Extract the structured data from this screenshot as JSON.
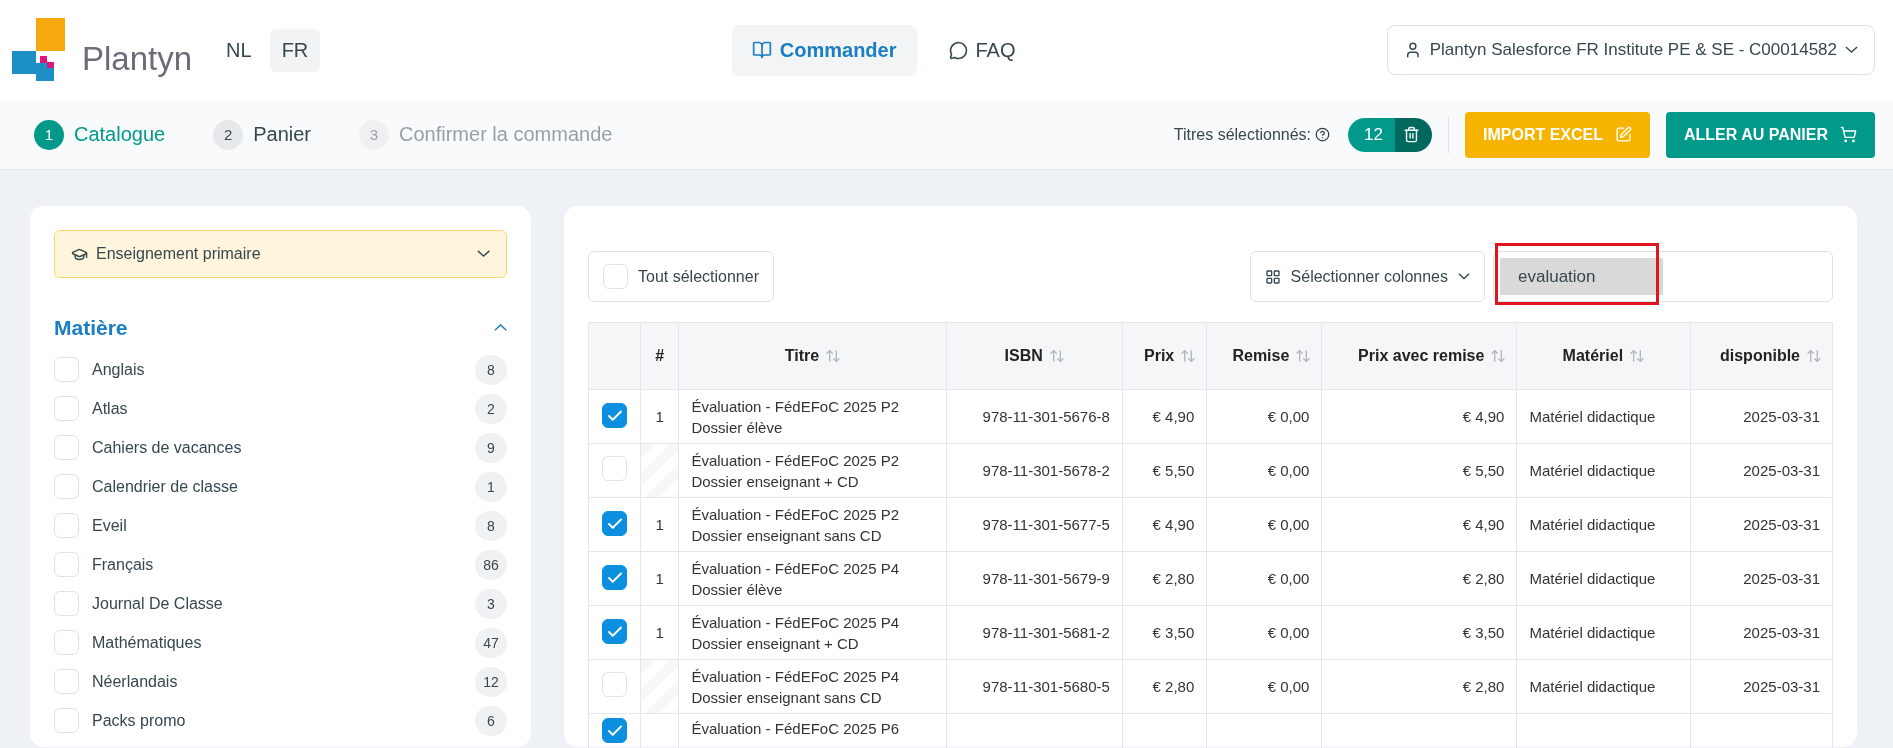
{
  "header": {
    "logo_text": "Plantyn",
    "languages": [
      {
        "label": "NL",
        "selected": false
      },
      {
        "label": "FR",
        "selected": true
      }
    ],
    "nav": [
      {
        "label": "Commander",
        "kind": "order",
        "selected": true
      },
      {
        "label": "FAQ",
        "kind": "faq",
        "selected": false
      }
    ],
    "account": "Plantyn Salesforce FR Institute PE & SE - C00014582"
  },
  "steps": [
    {
      "number": "1",
      "label": "Catalogue",
      "selected": true,
      "disabled": false
    },
    {
      "number": "2",
      "label": "Panier",
      "selected": false,
      "disabled": false
    },
    {
      "number": "3",
      "label": "Confirmer la commande",
      "selected": false,
      "disabled": true
    }
  ],
  "selection": {
    "label": "Titres sélectionnés:",
    "count": "12"
  },
  "actions": [
    {
      "label": "IMPORT EXCEL",
      "kind": "import"
    },
    {
      "label": "ALLER AU PANIER",
      "kind": "cart"
    }
  ],
  "sidebar": {
    "level_select": "Enseignement primaire",
    "section": {
      "title": "Matière",
      "expanded": true,
      "items": [
        {
          "label": "Anglais",
          "count": "8",
          "checked": false
        },
        {
          "label": "Atlas",
          "count": "2",
          "checked": false
        },
        {
          "label": "Cahiers de vacances",
          "count": "9",
          "checked": false
        },
        {
          "label": "Calendrier de classe",
          "count": "1",
          "checked": false
        },
        {
          "label": "Eveil",
          "count": "8",
          "checked": false
        },
        {
          "label": "Français",
          "count": "86",
          "checked": false
        },
        {
          "label": "Journal De Classe",
          "count": "3",
          "checked": false
        },
        {
          "label": "Mathématiques",
          "count": "47",
          "checked": false
        },
        {
          "label": "Néerlandais",
          "count": "12",
          "checked": false
        },
        {
          "label": "Packs promo",
          "count": "6",
          "checked": false
        }
      ]
    }
  },
  "toolbar": {
    "select_all": {
      "label": "Tout sélectionner",
      "checked": false
    },
    "columns_button": "Sélectionner colonnes",
    "search": {
      "value": "evaluation",
      "highlighted": true
    }
  },
  "table": {
    "columns": [
      {
        "label": "#",
        "sortable": false
      },
      {
        "label": "Titre",
        "sortable": true
      },
      {
        "label": "ISBN",
        "sortable": true
      },
      {
        "label": "Prix",
        "sortable": true
      },
      {
        "label": "Remise",
        "sortable": true
      },
      {
        "label": "Prix avec remise",
        "sortable": true
      },
      {
        "label": "Matériel",
        "sortable": true
      },
      {
        "label": "disponible",
        "sortable": true
      }
    ],
    "rows": [
      {
        "checked": true,
        "quantity": "1",
        "title": [
          "Évaluation - FédEFoC 2025 P2",
          "Dossier élève"
        ],
        "isbn": "978-11-301-5676-8",
        "price": "€ 4,90",
        "discount": "€ 0,00",
        "net_price": "€ 4,90",
        "material": "Matériel didactique",
        "available": "2025-03-31"
      },
      {
        "checked": false,
        "title": [
          "Évaluation - FédEFoC 2025 P2",
          "Dossier enseignant + CD"
        ],
        "isbn": "978-11-301-5678-2",
        "price": "€ 5,50",
        "discount": "€ 0,00",
        "net_price": "€ 5,50",
        "material": "Matériel didactique",
        "available": "2025-03-31"
      },
      {
        "checked": true,
        "quantity": "1",
        "title": [
          "Évaluation - FédEFoC 2025 P2",
          "Dossier enseignant sans CD"
        ],
        "isbn": "978-11-301-5677-5",
        "price": "€ 4,90",
        "discount": "€ 0,00",
        "net_price": "€ 4,90",
        "material": "Matériel didactique",
        "available": "2025-03-31"
      },
      {
        "checked": true,
        "quantity": "1",
        "title": [
          "Évaluation - FédEFoC 2025 P4",
          "Dossier élève"
        ],
        "isbn": "978-11-301-5679-9",
        "price": "€ 2,80",
        "discount": "€ 0,00",
        "net_price": "€ 2,80",
        "material": "Matériel didactique",
        "available": "2025-03-31"
      },
      {
        "checked": true,
        "quantity": "1",
        "title": [
          "Évaluation - FédEFoC 2025 P4",
          "Dossier enseignant + CD"
        ],
        "isbn": "978-11-301-5681-2",
        "price": "€ 3,50",
        "discount": "€ 0,00",
        "net_price": "€ 3,50",
        "material": "Matériel didactique",
        "available": "2025-03-31"
      },
      {
        "checked": false,
        "title": [
          "Évaluation - FédEFoC 2025 P4",
          "Dossier enseignant sans CD"
        ],
        "isbn": "978-11-301-5680-5",
        "price": "€ 2,80",
        "discount": "€ 0,00",
        "net_price": "€ 2,80",
        "material": "Matériel didactique",
        "available": "2025-03-31"
      },
      {
        "checked": true,
        "title": [
          "Évaluation - FédEFoC 2025 P6"
        ]
      }
    ]
  }
}
